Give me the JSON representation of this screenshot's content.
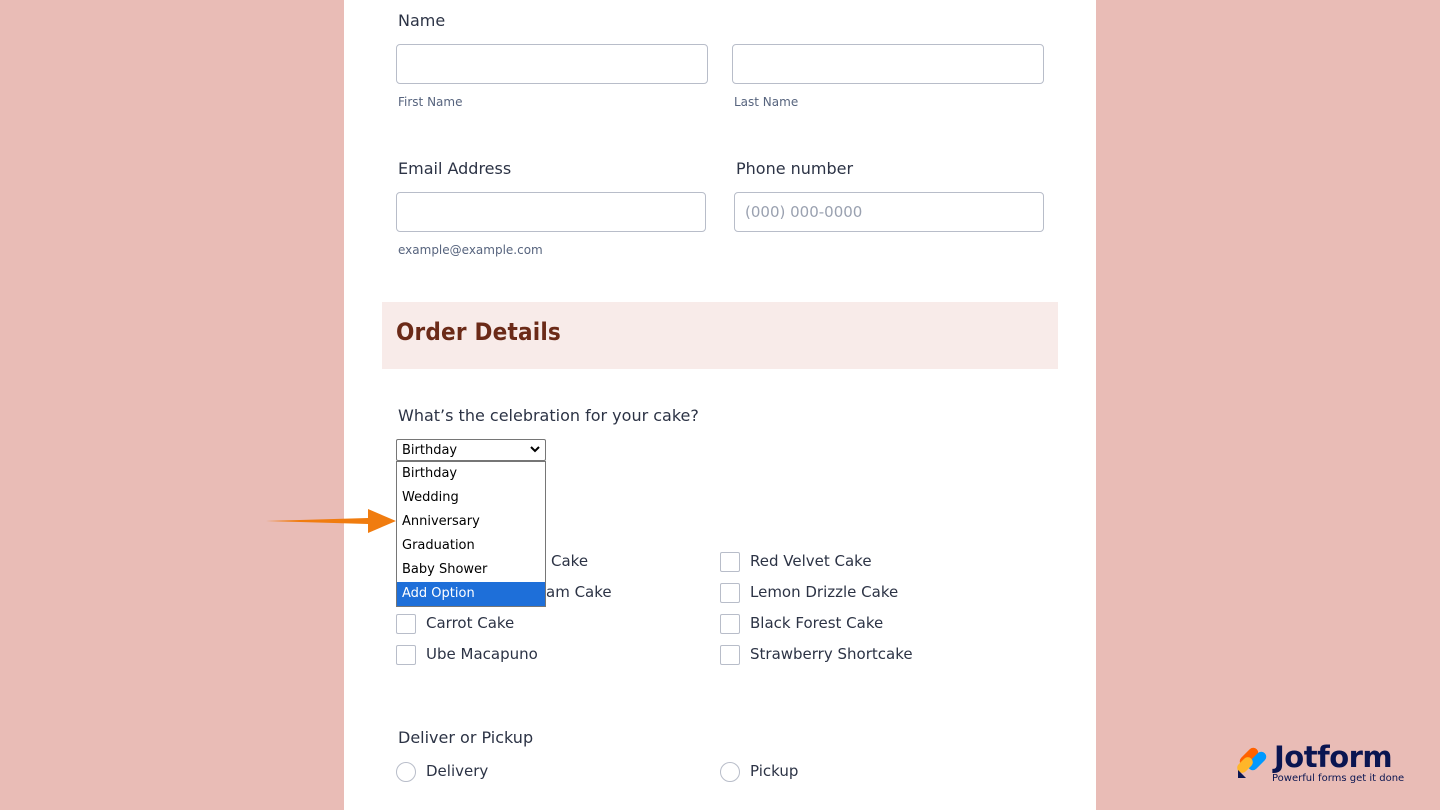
{
  "name_field": {
    "label": "Name",
    "first_sublabel": "First Name",
    "last_sublabel": "Last Name",
    "first_value": "",
    "last_value": ""
  },
  "email_field": {
    "label": "Email Address",
    "sublabel": "example@example.com",
    "value": ""
  },
  "phone_field": {
    "label": "Phone number",
    "placeholder": "(000) 000-0000",
    "value": ""
  },
  "section": {
    "title": "Order Details"
  },
  "celebration": {
    "question": "What’s the celebration for your cake?",
    "selected": "Birthday",
    "options": [
      "Birthday",
      "Wedding",
      "Anniversary",
      "Graduation",
      "Baby Shower",
      "Add Option"
    ],
    "highlighted": "Add Option"
  },
  "cakes": {
    "left": [
      "Cake",
      "am Cake",
      "Carrot Cake",
      "Ube Macapuno"
    ],
    "right": [
      "Red Velvet Cake",
      "Lemon Drizzle Cake",
      "Black Forest Cake",
      "Strawberry Shortcake"
    ]
  },
  "delivery": {
    "question": "Deliver or Pickup",
    "options": [
      "Delivery",
      "Pickup"
    ]
  },
  "branding": {
    "name": "Jotform",
    "tagline": "Powerful forms get it done"
  },
  "colors": {
    "background": "#e9bcb6",
    "section_bg": "#f8ebe9",
    "section_title": "#6b2a18",
    "highlight": "#1e6fd9",
    "arrow": "#f07c0f"
  }
}
